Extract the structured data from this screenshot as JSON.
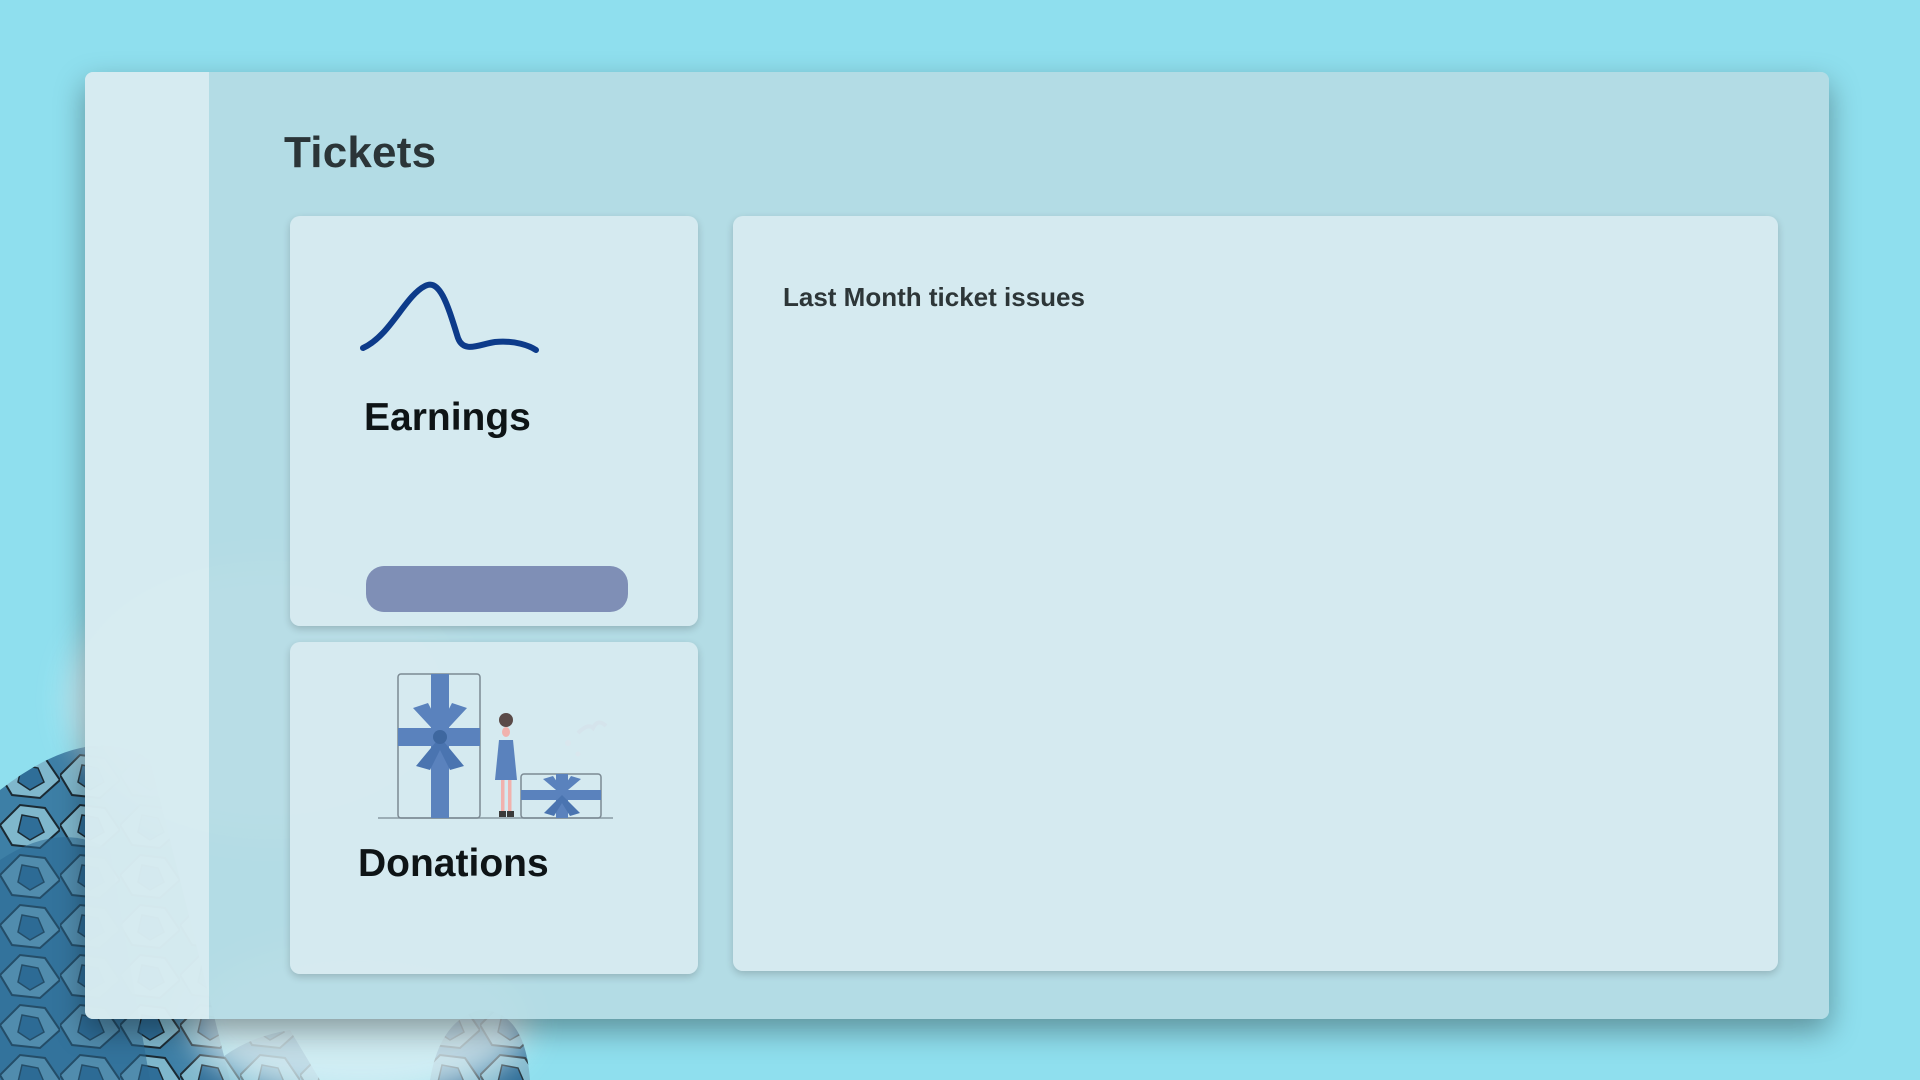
{
  "page": {
    "title": "Tickets"
  },
  "cards": {
    "earnings": {
      "title": "Earnings",
      "icon": "bell-curve-icon",
      "button_label": ""
    },
    "donations": {
      "title": "Donations",
      "illustration": "gift-boxes-illustration"
    },
    "chart": {
      "title": "Last Month ticket issues"
    }
  },
  "colors": {
    "background": "#8fdfee",
    "curve": "#0d3b8a",
    "button": "#7f8fb6",
    "gift": "#5a82bd"
  }
}
